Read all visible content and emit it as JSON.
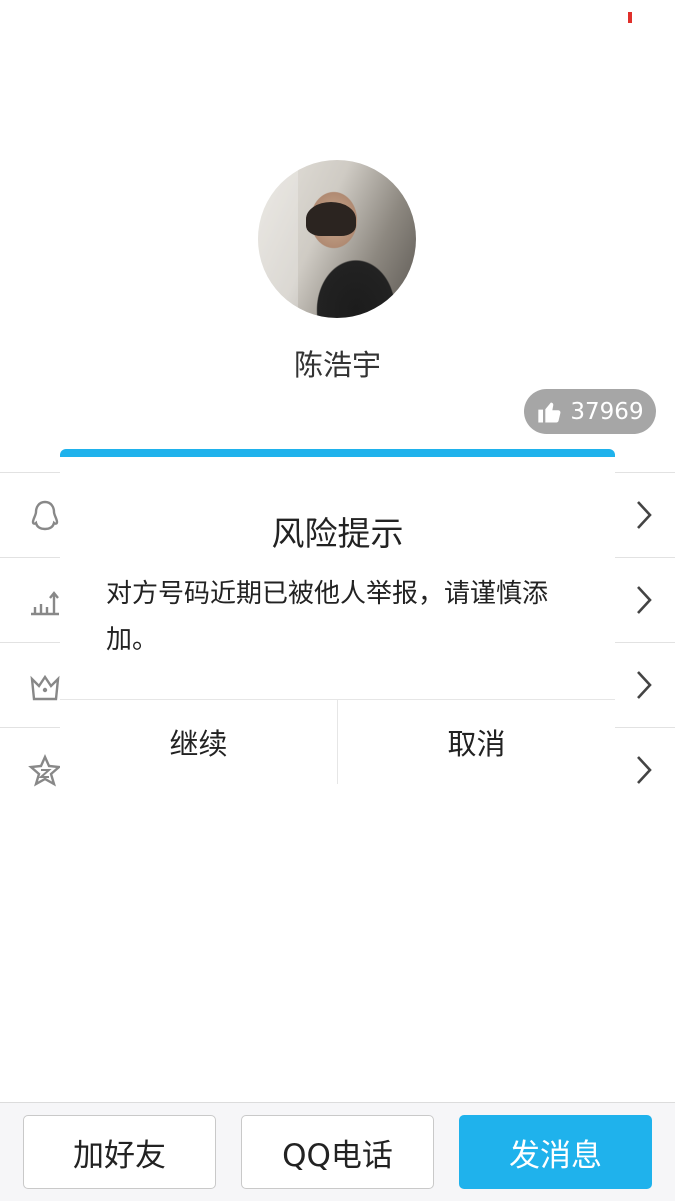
{
  "profile": {
    "name": "陈浩宇",
    "likes": "37969"
  },
  "dialog": {
    "title": "风险提示",
    "message": "对方号码近期已被他人举报，请谨慎添加。",
    "continue_label": "继续",
    "cancel_label": "取消",
    "accent_color": "#1fb2ec"
  },
  "list_rows": [
    {
      "icon": "qq-penguin-icon"
    },
    {
      "icon": "chart-icon"
    },
    {
      "icon": "crown-icon"
    },
    {
      "icon": "zone-star-icon"
    }
  ],
  "bottom_bar": {
    "add_friend_label": "加好友",
    "qq_call_label": "QQ电话",
    "send_message_label": "发消息"
  }
}
